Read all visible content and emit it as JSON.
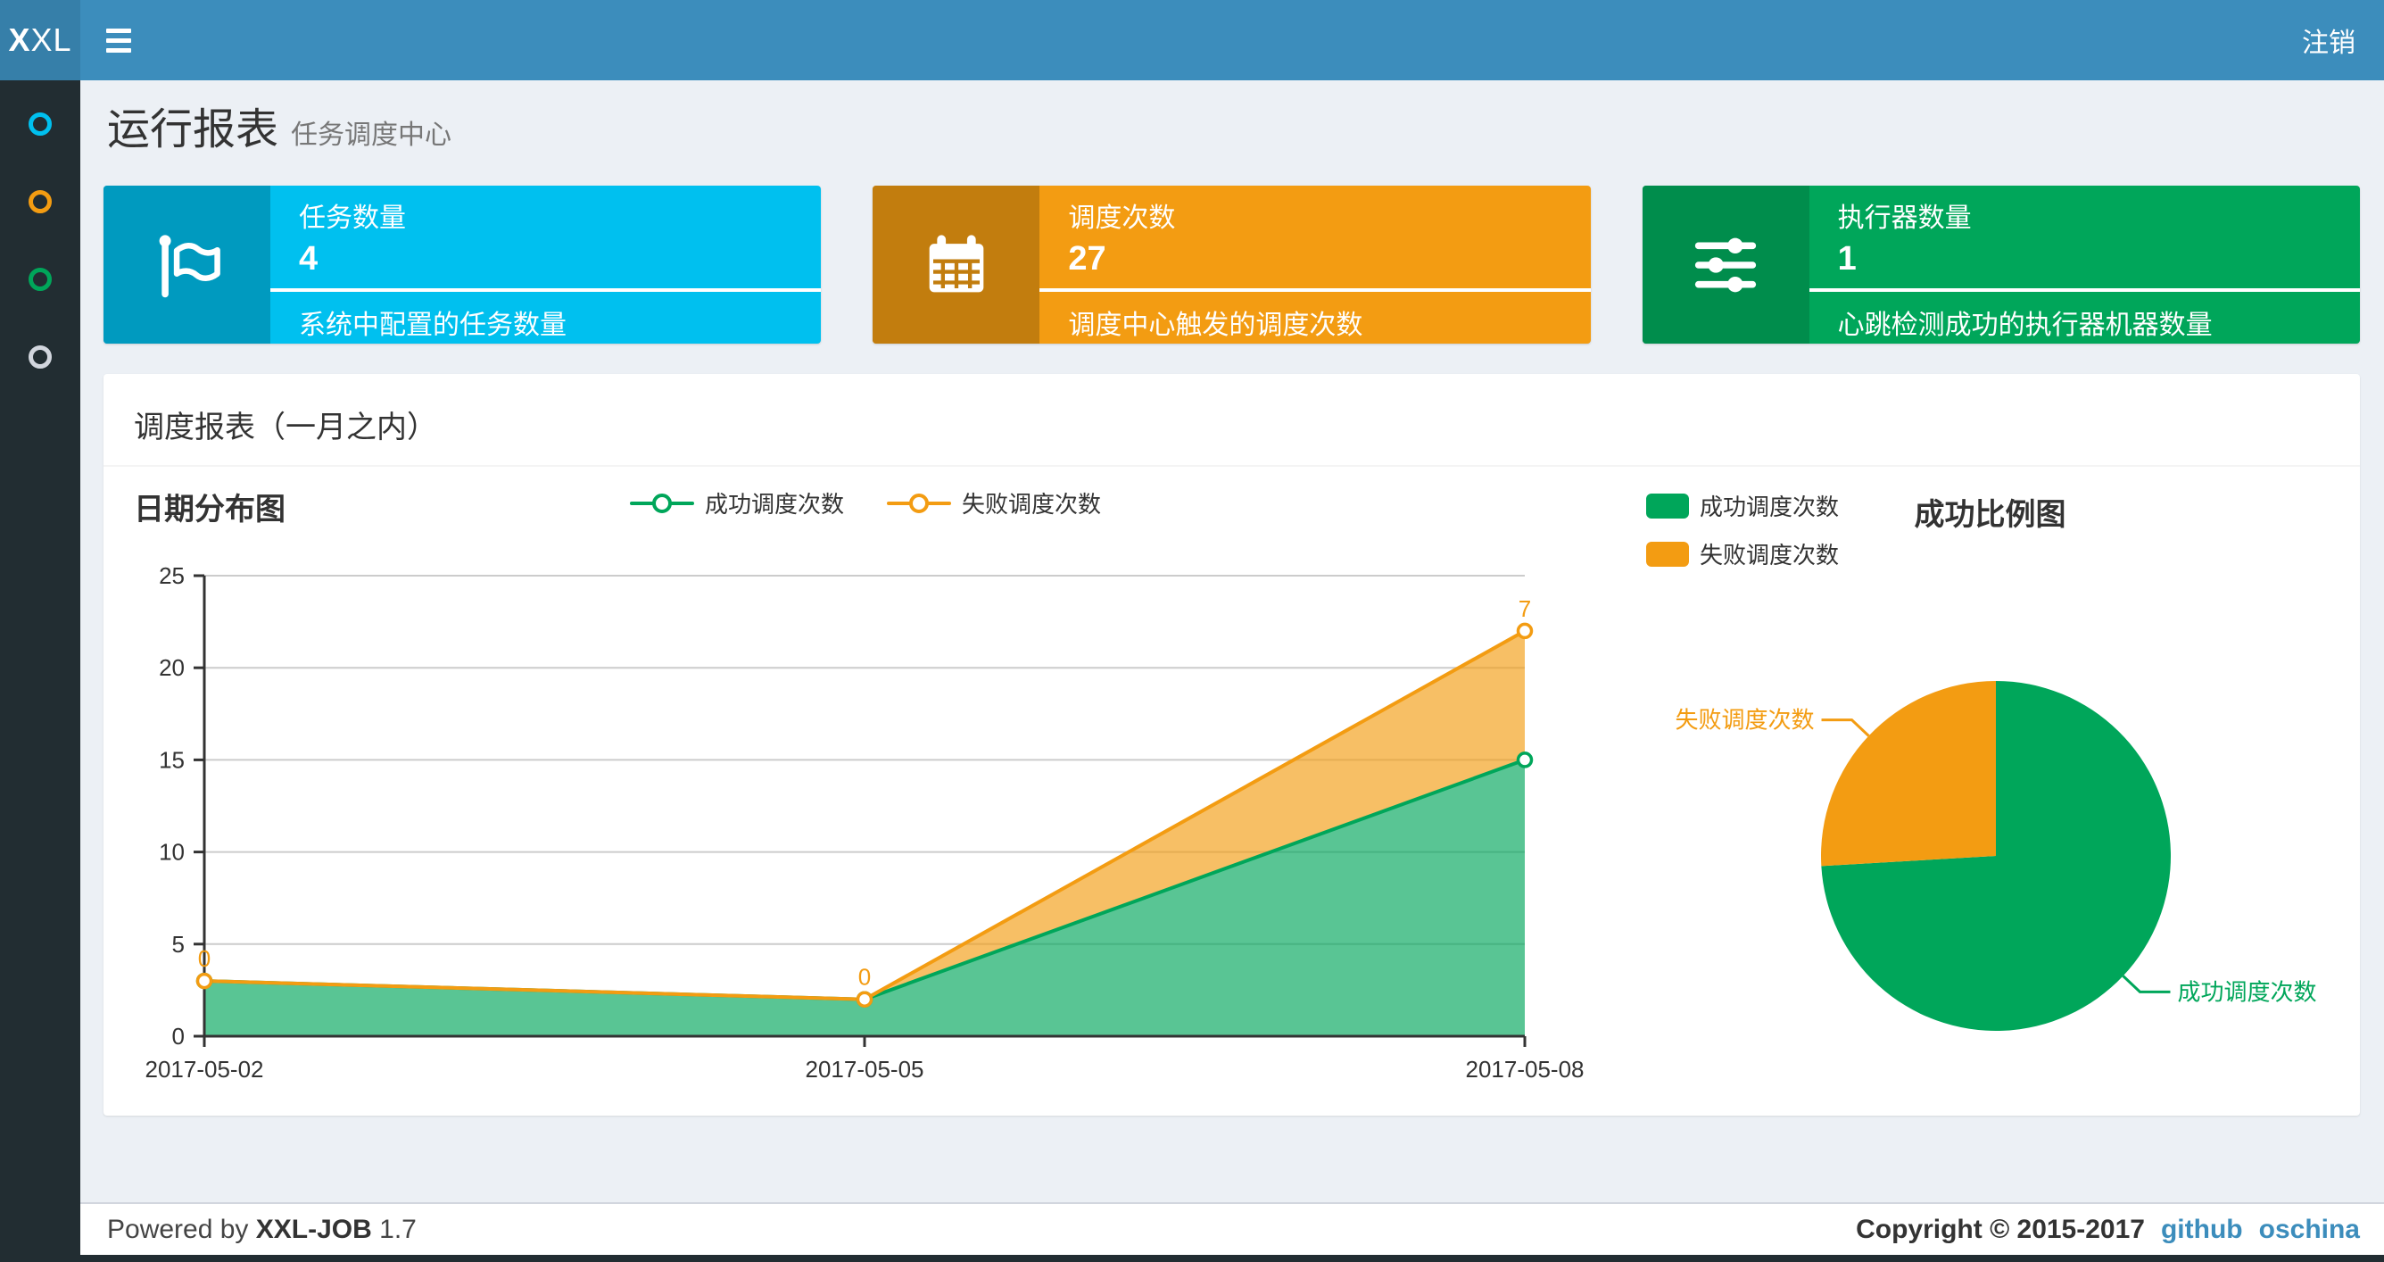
{
  "navbar": {
    "logo_bold": "X",
    "logo_rest": "XL",
    "menu_icon": "hamburger-icon",
    "logout_label": "注销"
  },
  "sidebar": {
    "items": [
      {
        "icon": "circle-o-icon",
        "color": "#00c0ef"
      },
      {
        "icon": "circle-o-icon",
        "color": "#f39c12"
      },
      {
        "icon": "circle-o-icon",
        "color": "#00a65a"
      },
      {
        "icon": "circle-o-icon",
        "color": "#d2d6de"
      }
    ]
  },
  "page_header": {
    "title": "运行报表",
    "subtitle": "任务调度中心"
  },
  "info_boxes": [
    {
      "icon": "flag-icon",
      "label": "任务数量",
      "value": "4",
      "desc": "系统中配置的任务数量",
      "bg": "#00c0ef",
      "icon_bg": "#009abf"
    },
    {
      "icon": "calendar-icon",
      "label": "调度次数",
      "value": "27",
      "desc": "调度中心触发的调度次数",
      "bg": "#f39c12",
      "icon_bg": "#c27d0e"
    },
    {
      "icon": "sliders-icon",
      "label": "执行器数量",
      "value": "1",
      "desc": "心跳检测成功的执行器机器数量",
      "bg": "#00a65a",
      "icon_bg": "#008d4c"
    }
  ],
  "panel": {
    "title": "调度报表（一月之内）"
  },
  "chart_data": [
    {
      "type": "area",
      "title": "日期分布图",
      "x": [
        "2017-05-02",
        "2017-05-05",
        "2017-05-08"
      ],
      "stacked": true,
      "series": [
        {
          "name": "成功调度次数",
          "color": "#00a65a",
          "values": [
            3,
            2,
            15
          ]
        },
        {
          "name": "失败调度次数",
          "color": "#f39c12",
          "values": [
            0,
            0,
            7
          ],
          "point_labels": [
            "0",
            "0",
            "7"
          ]
        }
      ],
      "ylim": [
        0,
        25
      ],
      "yticks": [
        0,
        5,
        10,
        15,
        20,
        25
      ],
      "grid": true,
      "legend_position": "top-center"
    },
    {
      "type": "pie",
      "title": "成功比例图",
      "slices": [
        {
          "name": "成功调度次数",
          "value": 20,
          "color": "#00a65a"
        },
        {
          "name": "失败调度次数",
          "value": 7,
          "color": "#f39c12"
        }
      ],
      "start_angle": 90,
      "clockwise": true,
      "label_position": "outside",
      "legend_position": "top-left"
    }
  ],
  "footer": {
    "powered_by": "Powered by",
    "brand": "XXL-JOB",
    "version": "1.7",
    "copyright": "Copyright © 2015-2017",
    "links": [
      {
        "label": "github"
      },
      {
        "label": "oschina"
      }
    ]
  }
}
